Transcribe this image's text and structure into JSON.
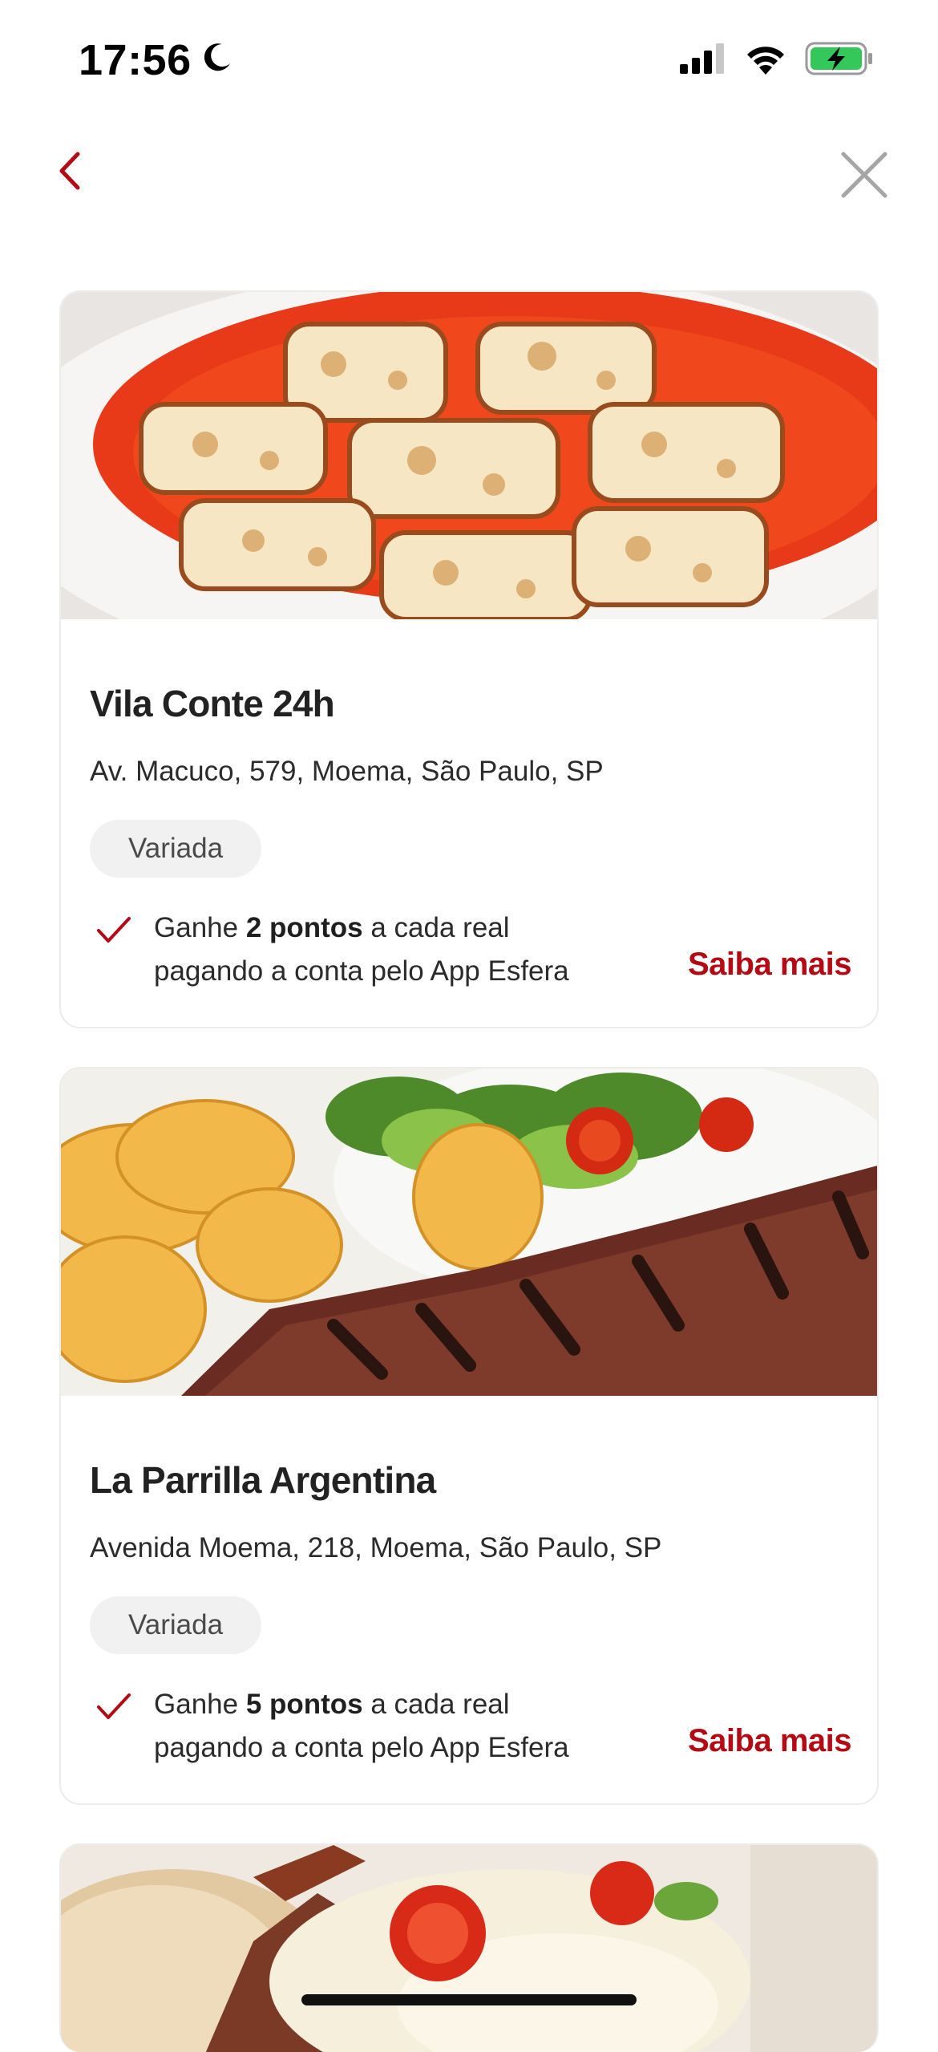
{
  "status_bar": {
    "time": "17:56",
    "moon_icon": "moon-icon",
    "signal_icon": "cellular-signal-icon",
    "wifi_icon": "wifi-icon",
    "battery_icon": "battery-charging-icon",
    "battery_color": "#34c759"
  },
  "nav": {
    "back_icon": "chevron-left-icon",
    "close_icon": "close-icon",
    "accent_color": "#b30a14"
  },
  "restaurants": [
    {
      "name": "Vila Conte 24h",
      "address": "Av. Macuco, 579, Moema, São Paulo, SP",
      "tag": "Variada",
      "points_prefix": "Ganhe ",
      "points_bold": "2 pontos",
      "points_suffix": " a cada real",
      "points_line2": "pagando a conta pelo App Esfera",
      "cta": "Saiba mais",
      "image": "parmigiana-dish-photo"
    },
    {
      "name": "La Parrilla Argentina",
      "address": "Avenida Moema, 218, Moema, São Paulo, SP",
      "tag": "Variada",
      "points_prefix": "Ganhe ",
      "points_bold": "5 pontos",
      "points_suffix": " a cada real",
      "points_line2": "pagando a conta pelo App Esfera",
      "cta": "Saiba mais",
      "image": "grilled-steak-photo"
    },
    {
      "image": "sandwich-photo"
    }
  ]
}
